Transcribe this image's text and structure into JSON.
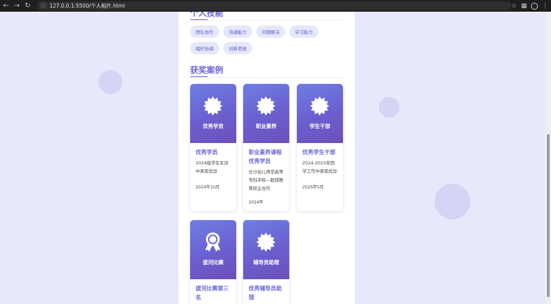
{
  "browser": {
    "url": "127.0.0.1:5500/个人相片.html",
    "nav_icons": [
      "back-icon",
      "forward-icon",
      "reload-icon"
    ],
    "right_icons": [
      "star-icon",
      "extensions-icon",
      "profile-icon",
      "menu-icon"
    ]
  },
  "skills": {
    "title": "个人技能",
    "tags": [
      "团队协作",
      "沟通能力",
      "问题解决",
      "学习能力",
      "组织协调",
      "创新思维"
    ]
  },
  "awards": {
    "title": "获奖案例",
    "items": [
      {
        "banner": "优秀学员",
        "icon": "badge-icon",
        "title": "优秀学员",
        "desc": "2024级学生军训中表现优异",
        "date": "2024年10月"
      },
      {
        "banner": "职业素养",
        "icon": "badge-icon",
        "title": "职业素养课程优秀学员",
        "desc": "长沙幼儿师范高等专科学校—联想教育校企合作",
        "date": "2024年"
      },
      {
        "banner": "学生干部",
        "icon": "badge-icon",
        "title": "优秀学生干部",
        "desc": "2024-2025年团学工作中表现优异",
        "date": "2025年5月"
      },
      {
        "banner": "拔河比赛",
        "icon": "medal-icon",
        "title": "拔河比赛第三名",
        "desc": "",
        "date": ""
      },
      {
        "banner": "辅导员助理",
        "icon": "badge-icon",
        "title": "优秀辅导员助理",
        "desc": "",
        "date": ""
      }
    ]
  },
  "colors": {
    "accent": "#6a66d6",
    "page_bg": "#e8e8fb",
    "tag_bg": "#e6e8fa",
    "banner_gradient_start": "#6f7ee4",
    "banner_gradient_end": "#6e4fb8"
  }
}
